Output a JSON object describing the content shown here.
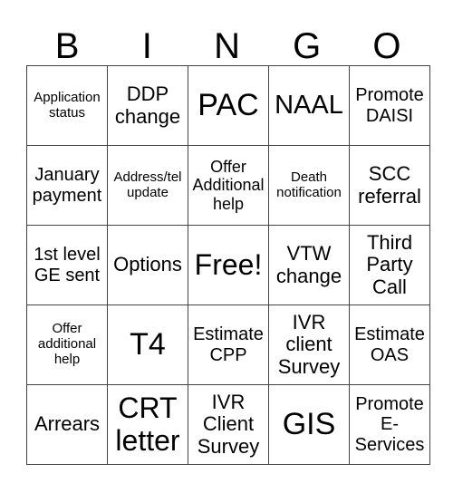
{
  "header": [
    "B",
    "I",
    "N",
    "G",
    "O"
  ],
  "cells": [
    [
      "Application status",
      "DDP change",
      "PAC",
      "NAAL",
      "Promote DAISI"
    ],
    [
      "January payment",
      "Address/tel update",
      "Offer Additional help",
      "Death notification",
      "SCC referral"
    ],
    [
      "1st level GE sent",
      "Options",
      "Free!",
      "VTW change",
      "Third Party Call"
    ],
    [
      "Offer additional help",
      "T4",
      "Estimate CPP",
      "IVR client Survey",
      "Estimate OAS"
    ],
    [
      "Arrears",
      "CRT letter",
      "IVR Client Survey",
      "GIS",
      "Promote E-Services"
    ]
  ]
}
